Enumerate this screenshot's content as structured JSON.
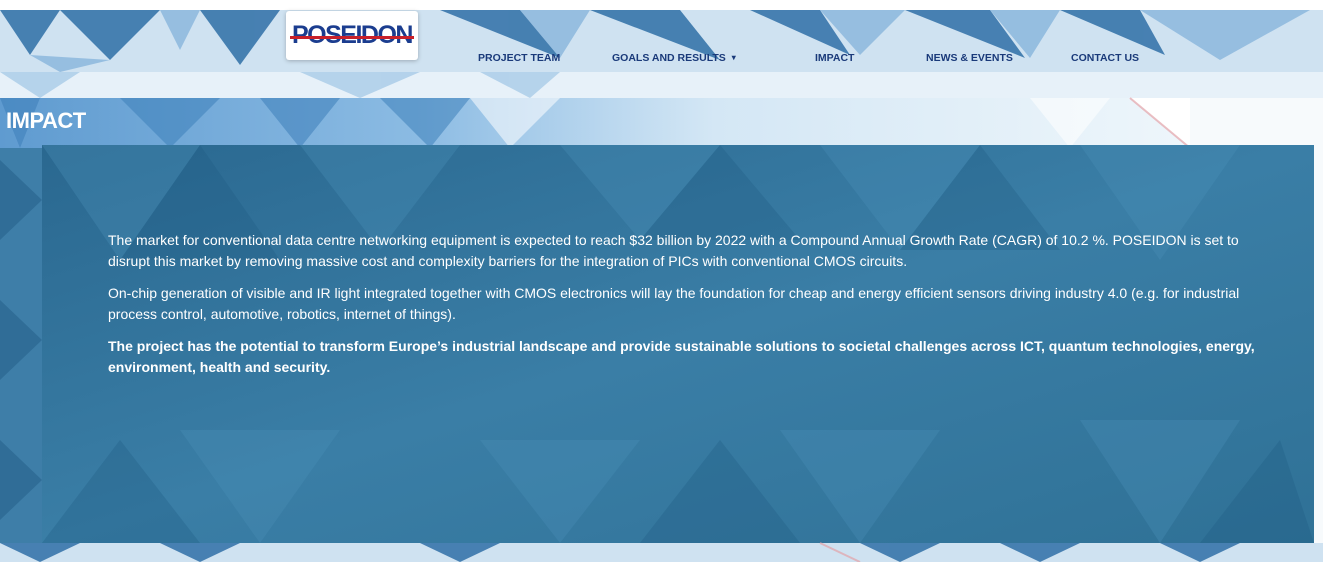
{
  "brand": {
    "logo_text": "POSEIDON"
  },
  "nav": {
    "items": [
      {
        "label": "PROJECT TEAM"
      },
      {
        "label": "GOALS AND RESULTS"
      },
      {
        "label": "IMPACT"
      },
      {
        "label": "NEWS & EVENTS"
      },
      {
        "label": "CONTACT US"
      }
    ],
    "dropdown_glyph": "▾"
  },
  "page": {
    "title": "IMPACT",
    "paragraphs": [
      "The market for conventional data centre networking equipment is expected to reach $32 billion by 2022 with a Compound Annual Growth Rate (CAGR) of 10.2 %. POSEIDON is set to disrupt this market by removing massive cost and complexity barriers for the integration of PICs with conventional CMOS circuits.",
      "On-chip generation of visible and IR light integrated together with CMOS electronics will lay the foundation for cheap and energy efficient sensors driving industry 4.0 (e.g. for industrial process control, automotive, robotics, internet of things).",
      "The project has the potential to transform Europe’s industrial landscape and provide sustainable solutions to societal challenges across ICT, quantum technologies, energy, environment, health and security."
    ]
  },
  "colors": {
    "panel": "#2c6e98",
    "nav_text": "#1a3a7a",
    "logo": "#1b3d8f",
    "logo_strike": "#c8202a"
  }
}
